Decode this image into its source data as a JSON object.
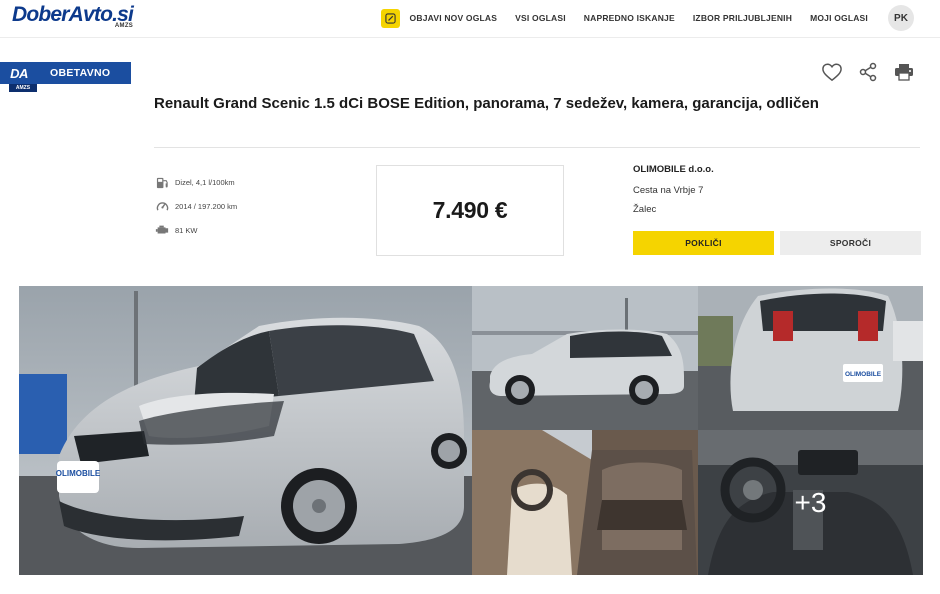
{
  "header": {
    "logo_text": "DoberAvto.si",
    "logo_sub": "AMZS",
    "nav": [
      {
        "label": "OBJAVI NOV OGLAS"
      },
      {
        "label": "VSI OGLASI"
      },
      {
        "label": "NAPREDNO ISKANJE"
      },
      {
        "label": "IZBOR PRILJUBLJENIH"
      },
      {
        "label": "MOJI OGLASI"
      }
    ],
    "avatar_initials": "PK"
  },
  "badge": {
    "logo": "DA",
    "label": "OBETAVNO",
    "sub": "AMZS"
  },
  "listing": {
    "title": "Renault Grand Scenic 1.5 dCi BOSE Edition, panorama, 7 sedežev, kamera, garancija, odličen",
    "specs": [
      {
        "icon": "fuel-pump-icon",
        "text": "Dizel, 4,1 l/100km"
      },
      {
        "icon": "odometer-icon",
        "text": "2014 / 197.200 km"
      },
      {
        "icon": "engine-icon",
        "text": "81 KW"
      }
    ],
    "price": "7.490 €"
  },
  "seller": {
    "name": "OLIMOBILE d.o.o.",
    "address": "Cesta na Vrbje 7",
    "city": "Žalec",
    "call_label": "POKLIČI",
    "message_label": "SPOROČI"
  },
  "gallery": {
    "more_label": "+3"
  },
  "colors": {
    "accent_yellow": "#f5d400",
    "brand_blue": "#1b4ea0"
  }
}
